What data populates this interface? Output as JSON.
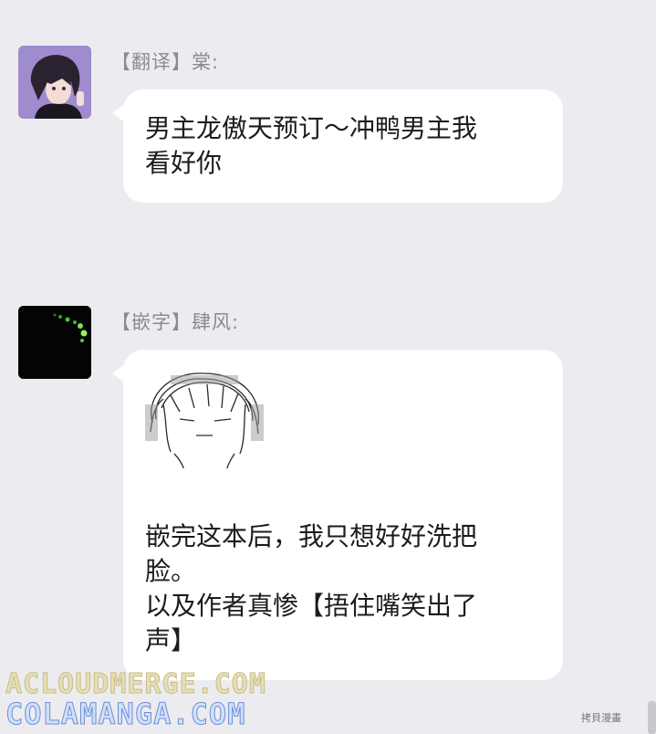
{
  "messages": [
    {
      "sender": "【翻译】棠:",
      "text": "男主龙傲天预订～冲鸭男主我\n看好你",
      "avatar": "purple-haired-character-avatar"
    },
    {
      "sender": "【嵌字】肆风:",
      "text": "嵌完这本后，我只想好好洗把\n脸。\n以及作者真惨【捂住嘴笑出了\n声】",
      "avatar": "dark-green-dots-avatar",
      "sticker": "scribbled-face-sticker"
    }
  ],
  "watermarks": {
    "line1": "ACLOUDMERGE.COM",
    "line2": "COLAMANGA.COM",
    "corner": "拷貝漫畫"
  }
}
